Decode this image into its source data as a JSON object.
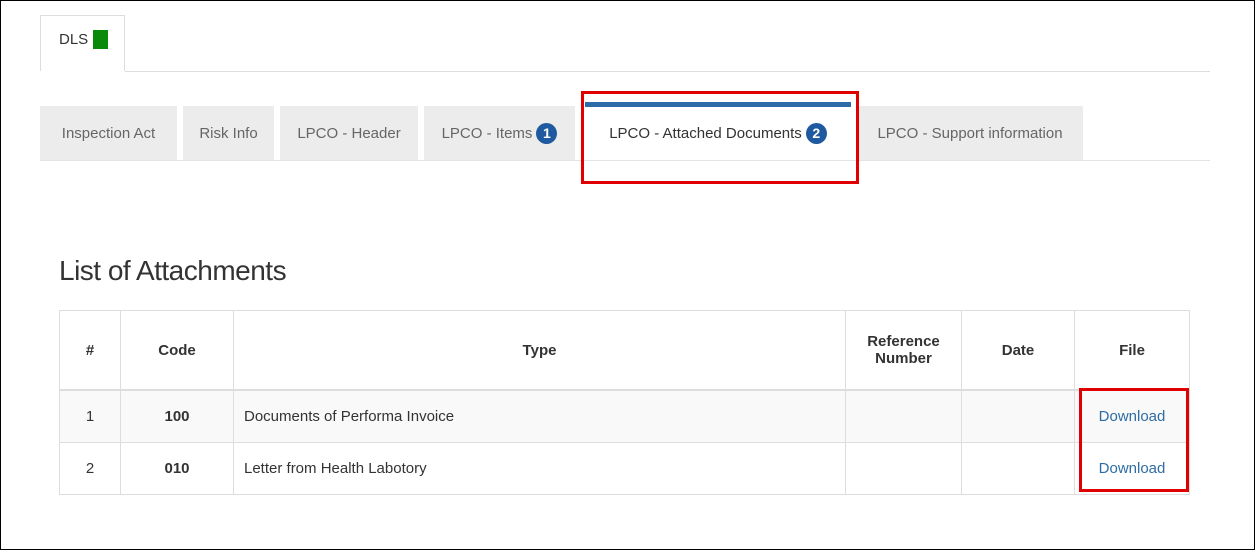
{
  "top_tab": {
    "label": "DLS",
    "indicator_color": "#0a8a0a"
  },
  "tabs": [
    {
      "label": "Inspection Act",
      "badge": ""
    },
    {
      "label": "Risk Info",
      "badge": ""
    },
    {
      "label": "LPCO - Header",
      "badge": ""
    },
    {
      "label": "LPCO - Items",
      "badge": "1"
    },
    {
      "label": "LPCO - Attached Documents",
      "badge": "2",
      "active": true
    },
    {
      "label": "LPCO - Support information",
      "badge": ""
    }
  ],
  "section": {
    "title": "List of Attachments"
  },
  "table": {
    "headers": {
      "num": "#",
      "code": "Code",
      "type": "Type",
      "ref_line1": "Reference",
      "ref_line2": "Number",
      "date": "Date",
      "file": "File"
    },
    "rows": [
      {
        "num": "1",
        "code": "100",
        "type": "Documents of Performa Invoice",
        "ref": "",
        "date": "",
        "file": "Download"
      },
      {
        "num": "2",
        "code": "010",
        "type": "Letter from Health Labotory",
        "ref": "",
        "date": "",
        "file": "Download"
      }
    ]
  },
  "colors": {
    "accent": "#2c6aa8",
    "badge": "#1f5aa0",
    "highlight": "#e00000",
    "link": "#2e6da4"
  }
}
